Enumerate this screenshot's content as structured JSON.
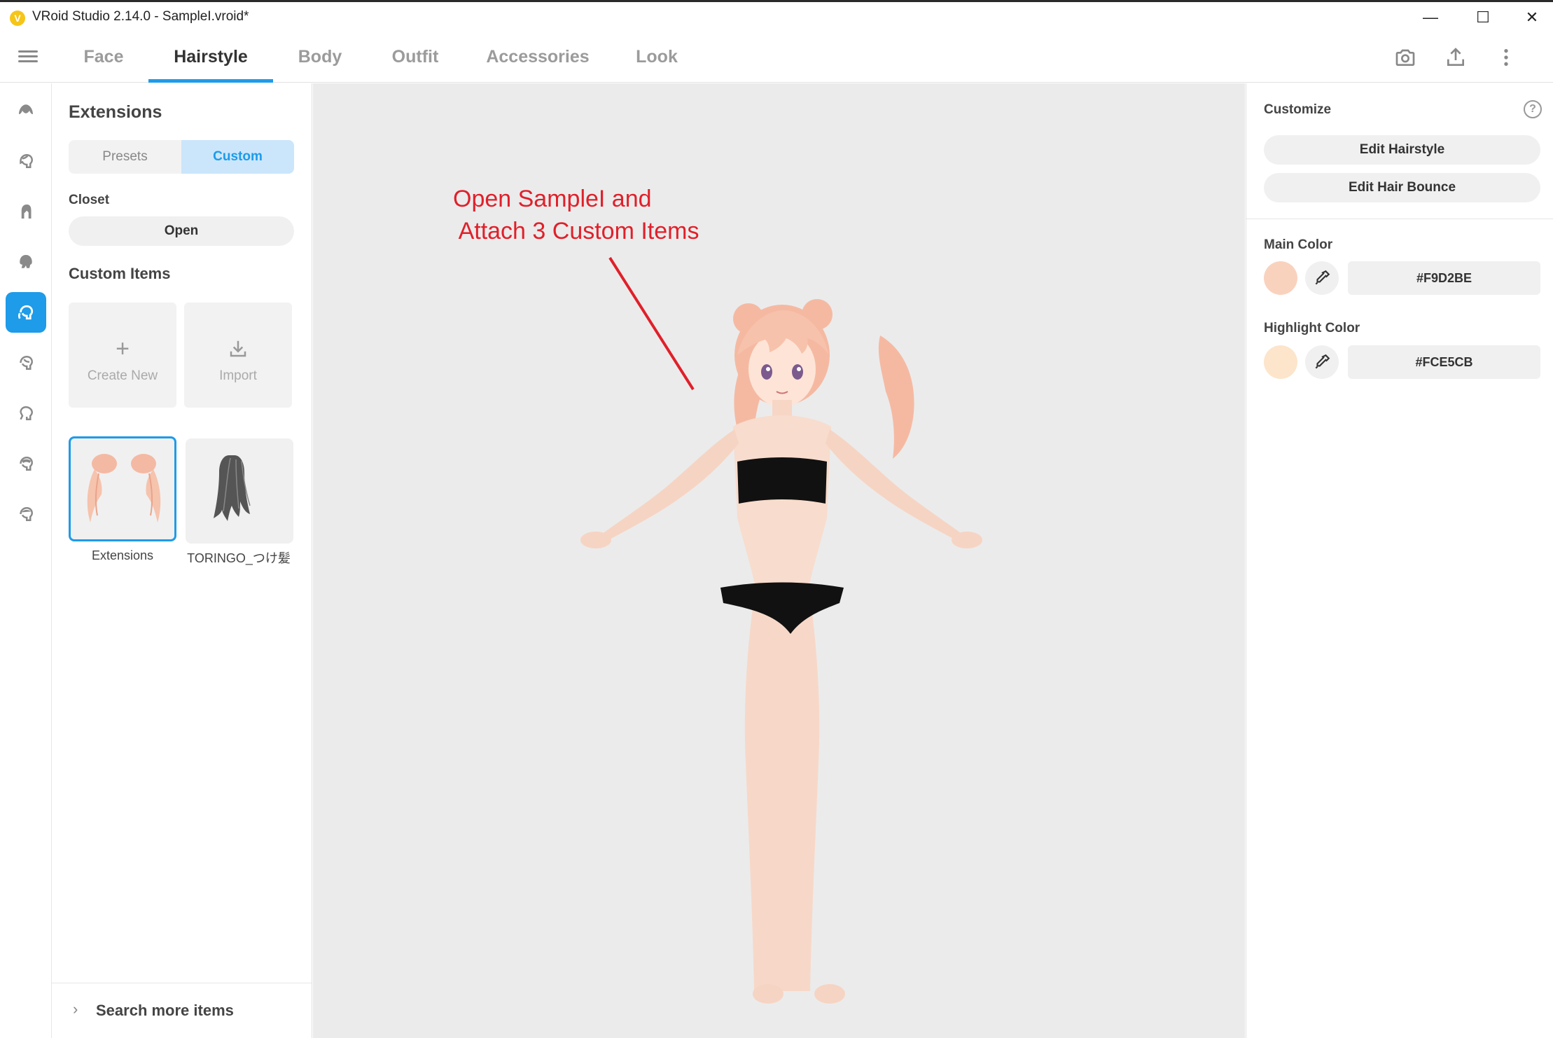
{
  "window": {
    "logo_glyph": "V",
    "title": "VRoid Studio 2.14.0 - SampleI.vroid*",
    "minimize": "—",
    "maximize": "☐",
    "close": "✕"
  },
  "tabs": [
    {
      "label": "Face"
    },
    {
      "label": "Hairstyle"
    },
    {
      "label": "Body"
    },
    {
      "label": "Outfit"
    },
    {
      "label": "Accessories"
    },
    {
      "label": "Look"
    }
  ],
  "active_tab": "Hairstyle",
  "top_icons": [
    "camera-icon",
    "export-icon",
    "more-vertical-icon"
  ],
  "rail": {
    "items": [
      "hair-base-icon",
      "front-hair-icon",
      "back-hair-icon",
      "side-hair-icon",
      "extensions-icon",
      "ahoge-icon",
      "hair-accent-icon",
      "hair-style-icon",
      "hair-other-icon"
    ],
    "active_index": 4
  },
  "left_panel": {
    "title": "Extensions",
    "segment": {
      "presets": "Presets",
      "custom": "Custom",
      "active": "Custom"
    },
    "closet_label": "Closet",
    "open_button": "Open",
    "custom_items_label": "Custom Items",
    "create_new": {
      "label": "Create New",
      "icon": "+"
    },
    "import": {
      "label": "Import",
      "icon": "⤓"
    },
    "items": [
      {
        "label": "Extensions",
        "selected": true
      },
      {
        "label": "TORINGO_つけ髪",
        "selected": false
      }
    ],
    "search_more": {
      "chevron": "›",
      "label": "Search more items"
    }
  },
  "viewport": {
    "annotation": "Open SampleI and\n Attach 3 Custom Items",
    "annotation_color": "#e0202a"
  },
  "right_panel": {
    "customize_label": "Customize",
    "help_glyph": "?",
    "edit_hairstyle": "Edit Hairstyle",
    "edit_hair_bounce": "Edit Hair Bounce",
    "main_color_label": "Main Color",
    "main_color_hex": "#F9D2BE",
    "highlight_color_label": "Highlight Color",
    "highlight_color_hex": "#FCE5CB"
  },
  "colors": {
    "accent": "#1e9be9",
    "main_color": "#F9D2BE",
    "highlight_color": "#FCE5CB"
  }
}
